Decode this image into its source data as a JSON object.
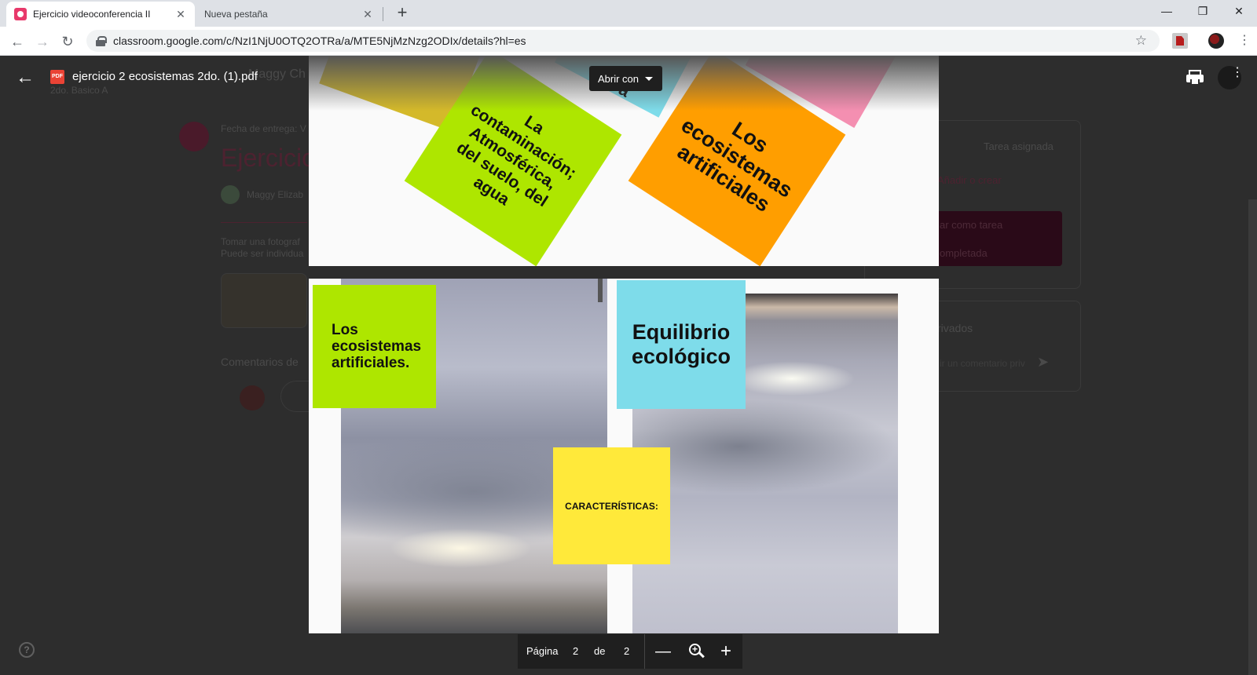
{
  "browser": {
    "tabs": [
      {
        "title": "Ejercicio videoconferencia II",
        "active": true
      },
      {
        "title": "Nueva pestaña",
        "active": false
      }
    ],
    "new_tab": "+",
    "url": "classroom.google.com/c/NzI1NjU0OTQ2OTRa/a/MTE5NjMzNzg2ODIx/details?hl=es"
  },
  "classroom_bg": {
    "teacher_header": "Maggy Ch",
    "class_name": "2do. Basico A",
    "due_label": "Fecha de entrega: V",
    "assignment_title": "Ejercicio",
    "author": "Maggy Elizab",
    "instructions_1": "Tomar una fotograf",
    "instructions_2": "Puede ser individua",
    "comments_label": "Comentarios de",
    "status": "Tarea asignada",
    "add_create": "Añadir o crear",
    "mark_done_1": "ar como tarea",
    "mark_done_2": "ompletada",
    "private_comments": "rivados",
    "private_placeholder": "ir un comentario priv"
  },
  "viewer": {
    "file_name": "ejercicio 2 ecosistemas 2do. (1).pdf",
    "pdf_badge": "PDF",
    "open_with": "Abrir con"
  },
  "page1": {
    "note_green": "La contaminación; Atmosférica, del suelo, del agua",
    "note_orange": "Los ecosistemas artificiales",
    "note_cyan_partial": "a"
  },
  "page2": {
    "note_green": "Los ecosistemas artificiales.",
    "note_cyan": "Equilibrio ecológico",
    "note_yellow": "CARACTERÍSTICAS:"
  },
  "pager": {
    "page_label": "Página",
    "current_page": "2",
    "of_label": "de",
    "total_pages": "2"
  },
  "colors": {
    "note_green": "#aee600",
    "note_orange": "#ff9e00",
    "note_cyan": "#7edcea",
    "note_yellow": "#ffe93a",
    "note_pink": "#f48fb1",
    "note_mustard": "#d4b92a"
  },
  "icons": [
    "back-arrow-icon",
    "pdf-file-icon",
    "print-icon",
    "more-vert-icon",
    "zoom-out-icon",
    "zoom-in-icon",
    "plus-icon",
    "help-icon",
    "star-icon",
    "lock-icon"
  ]
}
